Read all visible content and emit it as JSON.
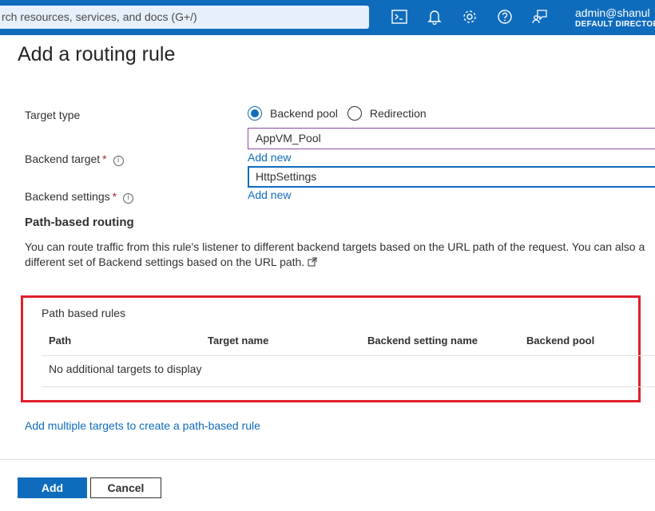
{
  "topbar": {
    "search_placeholder": "rch resources, services, and docs (G+/)",
    "icons": [
      "cloud-shell-icon",
      "bell-icon",
      "gear-icon",
      "help-icon",
      "feedback-icon"
    ],
    "account_name": "admin@shanul",
    "account_directory": "DEFAULT DIRECTORY"
  },
  "page": {
    "title": "Add a routing rule"
  },
  "form": {
    "target_type_label": "Target type",
    "target_type_options": [
      "Backend pool",
      "Redirection"
    ],
    "target_type_selected": "Backend pool",
    "backend_target_label": "Backend target",
    "backend_target_value": "AppVM_Pool",
    "backend_target_add_new": "Add new",
    "backend_settings_label": "Backend settings",
    "backend_settings_value": "HttpSettings",
    "backend_settings_add_new": "Add new",
    "required_mark": "*",
    "info_glyph": "i"
  },
  "path_routing": {
    "title": "Path-based routing",
    "description": "You can route traffic from this rule's listener to different backend targets based on the URL path of the request. You can also a different set of Backend settings based on the URL path.",
    "rules_title": "Path based rules",
    "columns": [
      "Path",
      "Target name",
      "Backend setting name",
      "Backend pool"
    ],
    "empty_message": "No additional targets to display",
    "add_link": "Add multiple targets to create a path-based rule"
  },
  "footer": {
    "add_label": "Add",
    "cancel_label": "Cancel"
  },
  "colors": {
    "accent": "#0f6cbd",
    "highlight_border": "#e0202b",
    "required": "#a4262c"
  }
}
